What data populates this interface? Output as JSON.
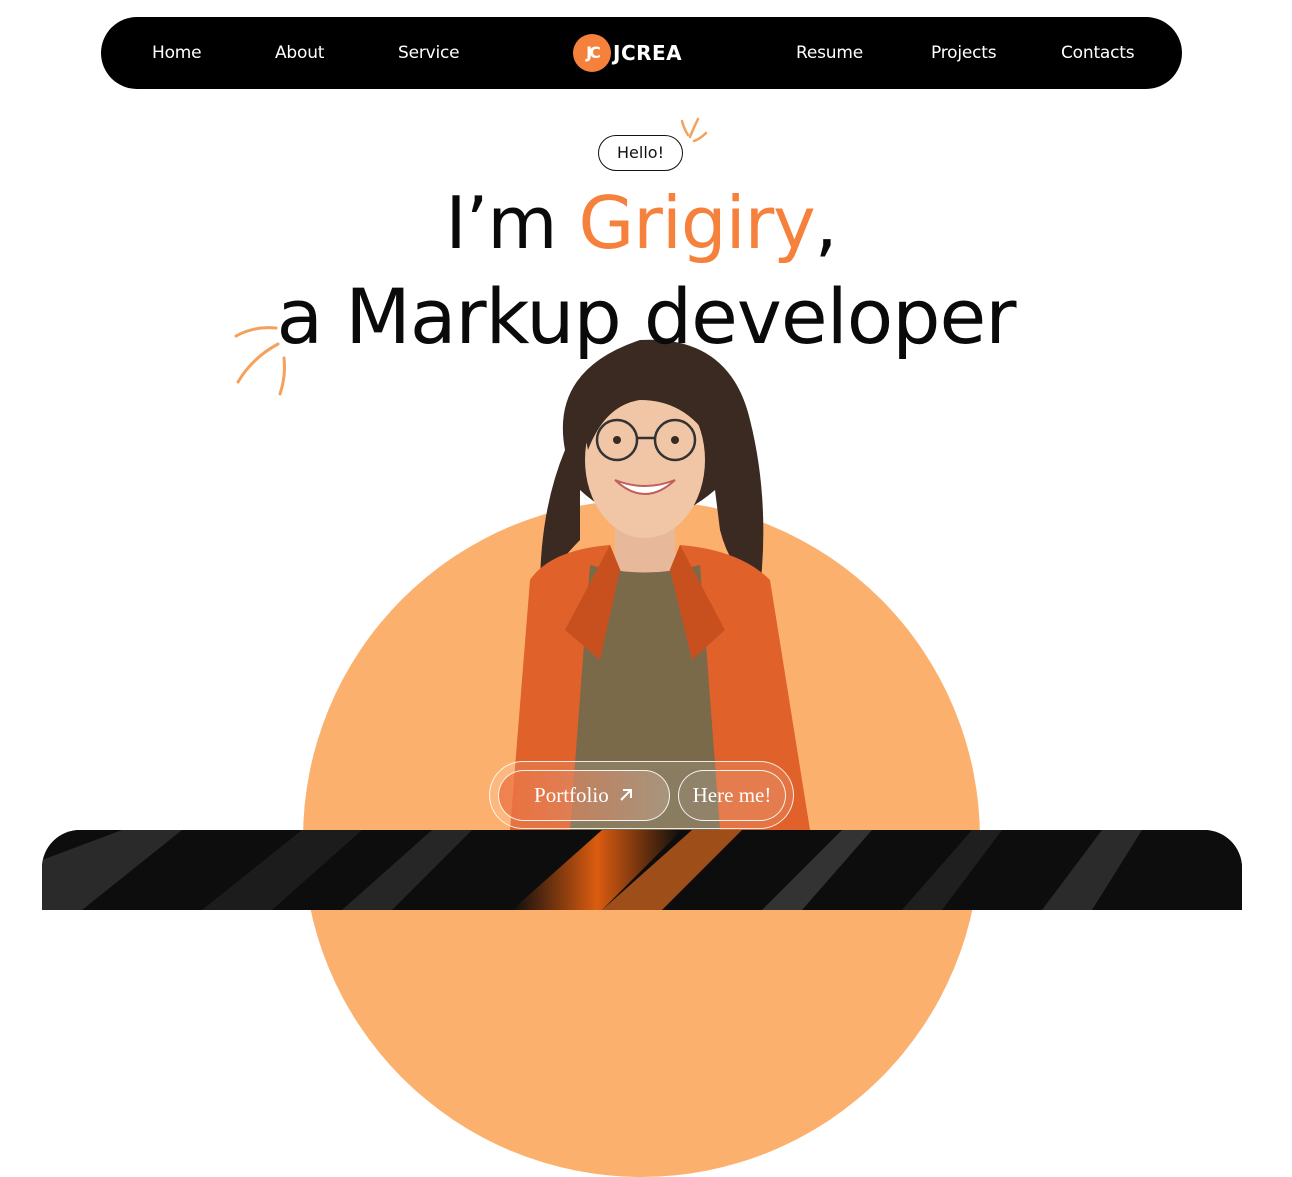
{
  "nav": {
    "left_links": [
      "Home",
      "About",
      "Service"
    ],
    "right_links": [
      "Resume",
      "Projects",
      "Contacts"
    ],
    "logo_mark": "JC",
    "logo_text": "JCREA"
  },
  "hero": {
    "greeting": "Hello!",
    "line1_prefix": "I’m ",
    "name": "Grigiry",
    "line1_suffix": ",",
    "line2": "a Markup developer"
  },
  "cta": {
    "portfolio_label": "Portfolio",
    "portfolio_icon": "arrow-up-right-icon",
    "hire_label": "Here me!"
  },
  "colors": {
    "accent": "#f5813c",
    "circle": "#fcb06e",
    "nav_bg": "#000000"
  }
}
